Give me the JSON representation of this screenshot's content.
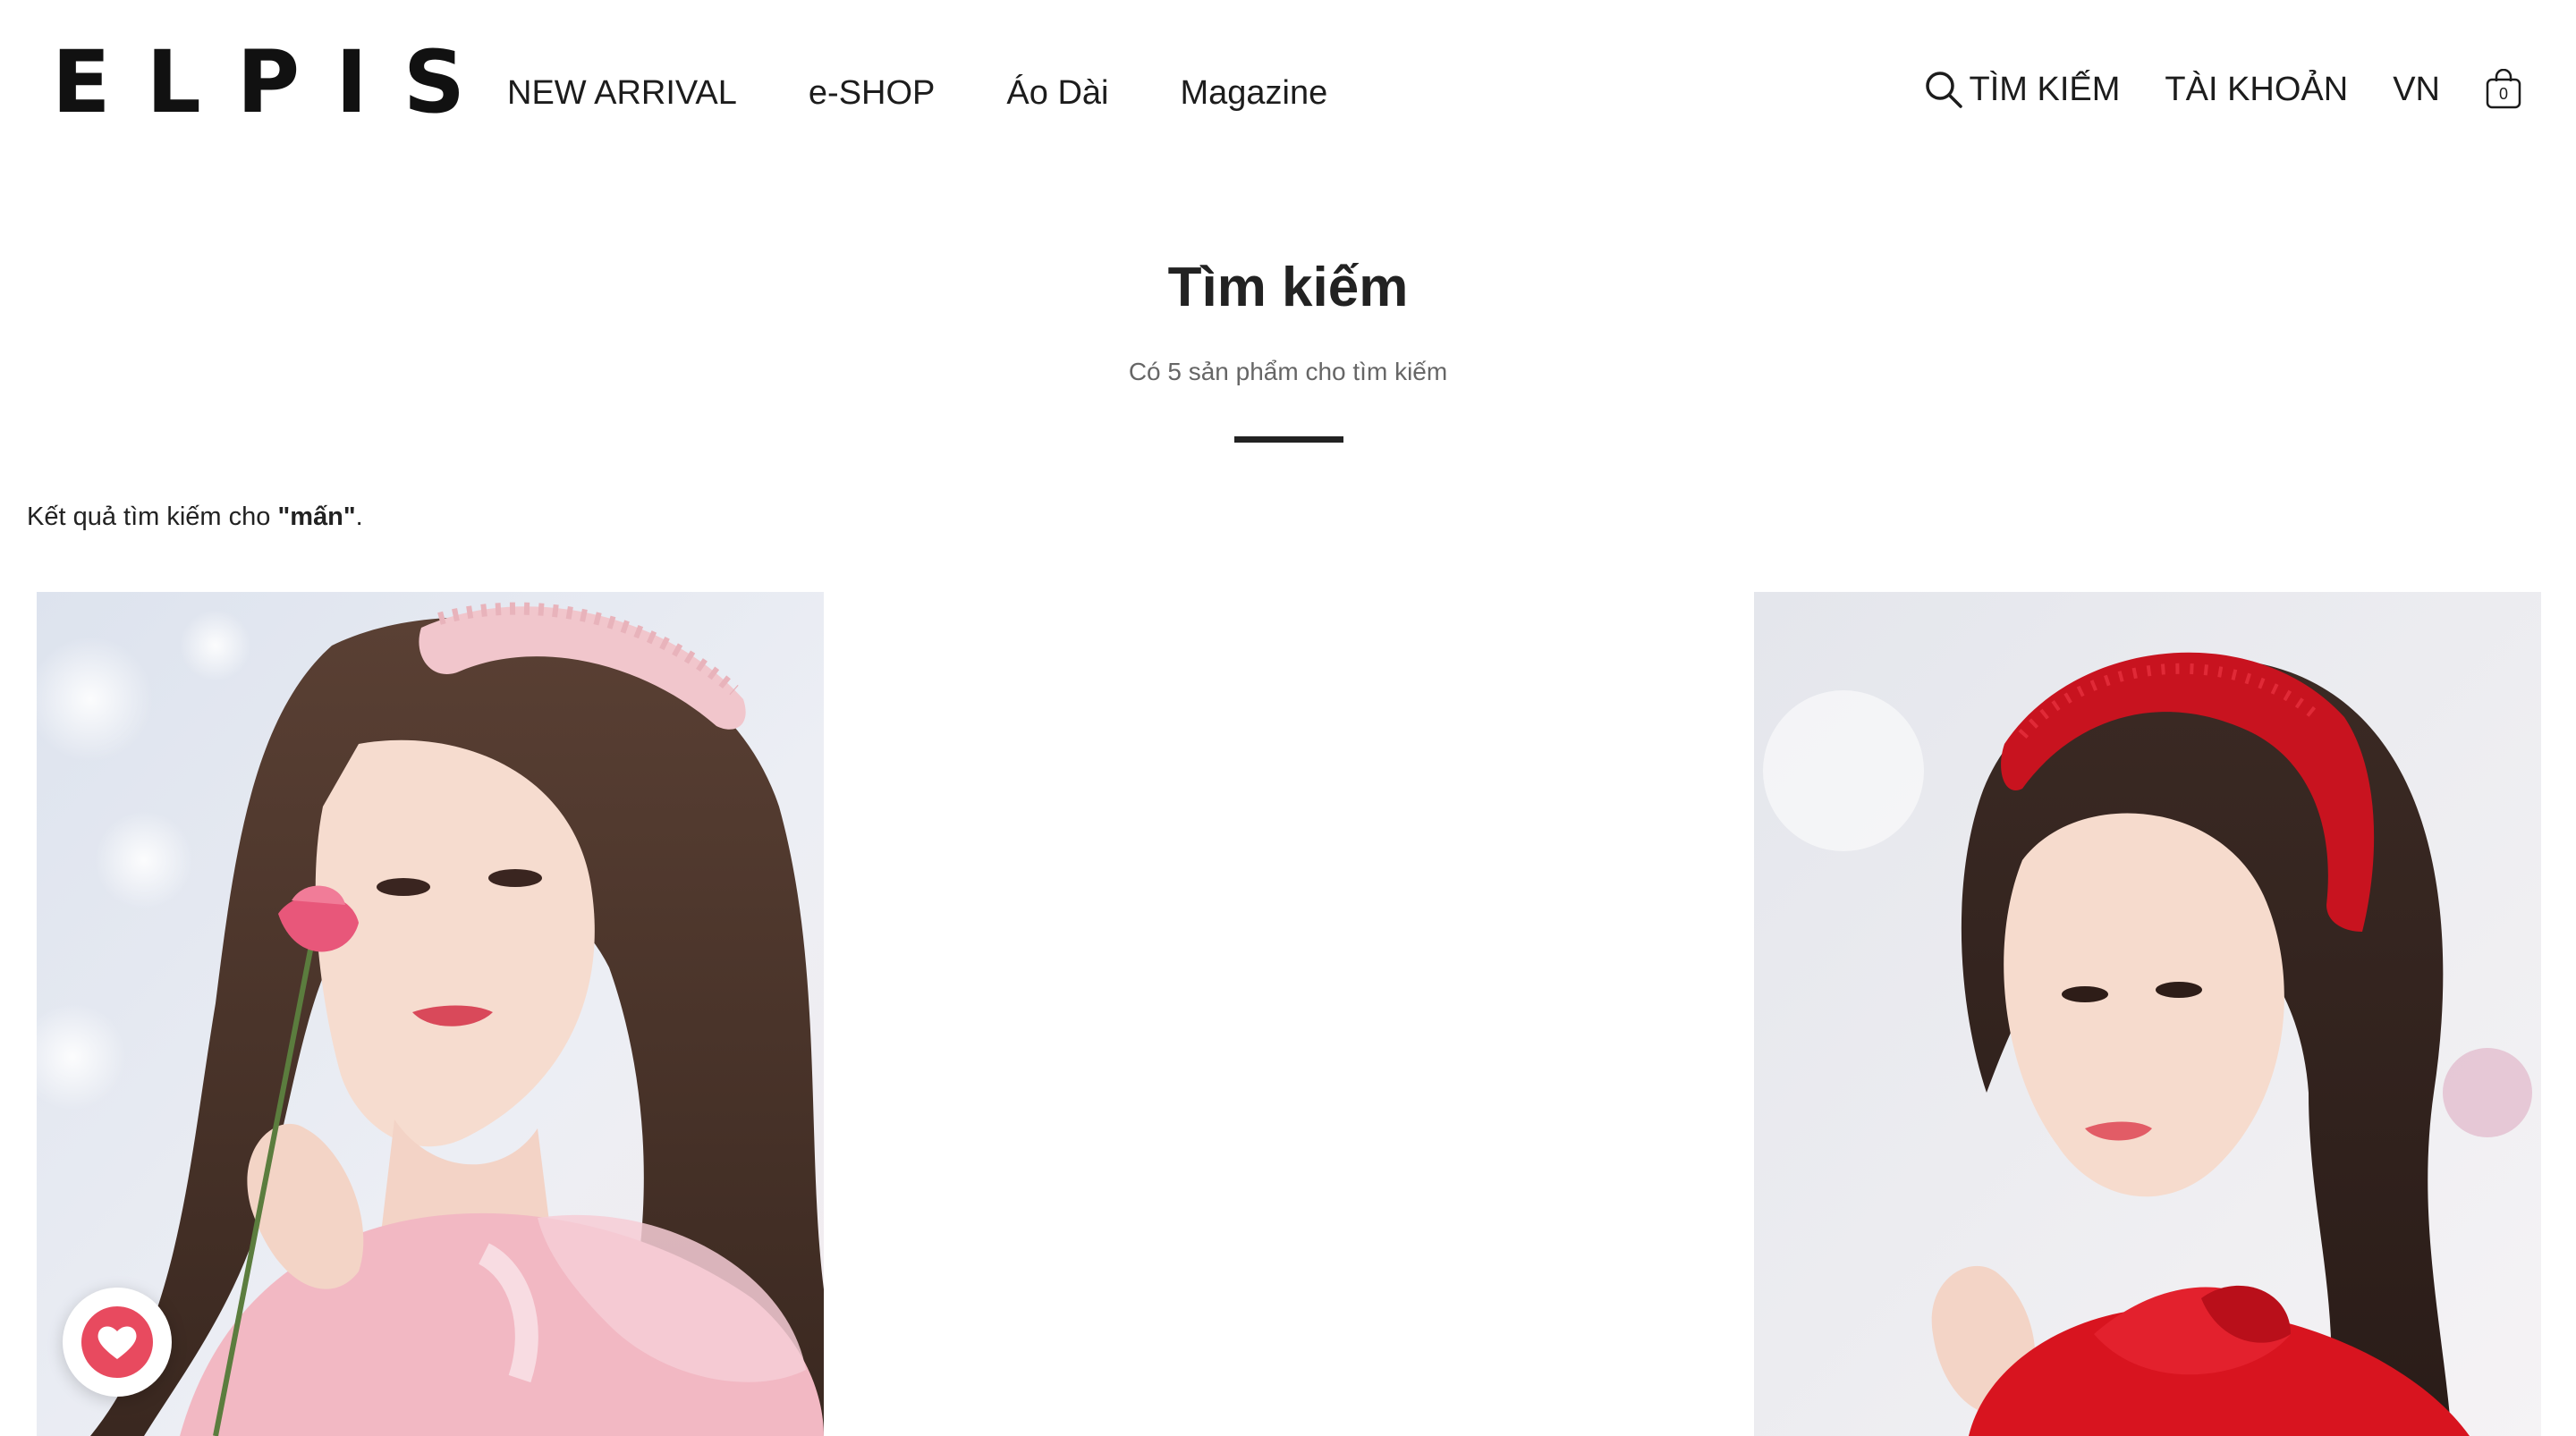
{
  "header": {
    "logo": "ELPIS",
    "nav": [
      "NEW ARRIVAL",
      "e-SHOP",
      "Áo Dài",
      "Magazine"
    ],
    "search_label": "TÌM KIẾM",
    "account_label": "TÀI KHOẢN",
    "language": "VN",
    "cart_count": "0"
  },
  "search_page": {
    "title": "Tìm kiếm",
    "subtitle": "Có 5 sản phẩm cho tìm kiếm",
    "result_prefix": "Kết quả tìm kiếm cho ",
    "query": "\"mấn\"",
    "result_suffix": "."
  },
  "products": [
    {
      "icon": "product-photo-pink-lace-headband"
    },
    {
      "icon": "product-photo-red-headband"
    }
  ],
  "wishlist": {
    "icon": "heart-icon"
  },
  "colors": {
    "text": "#1c1c1c",
    "subtitle": "#666666",
    "divider": "#222222",
    "wishlist_accent": "#e84a5f"
  }
}
